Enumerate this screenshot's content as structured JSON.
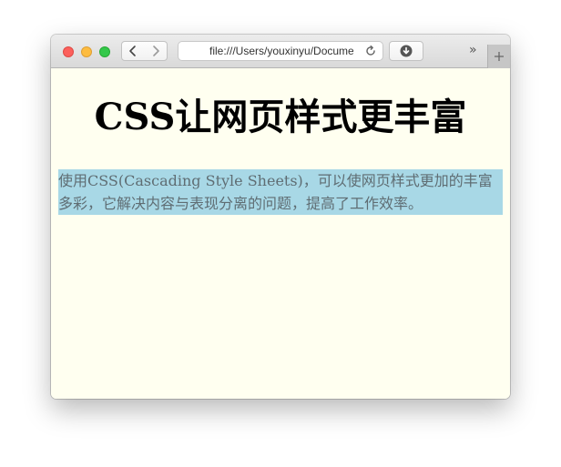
{
  "browser": {
    "url": "file:///Users/youxinyu/Documents/",
    "overflow_glyph": "»",
    "icons": {
      "back": "chevron-left-icon",
      "forward": "chevron-right-icon",
      "reload": "reload-icon",
      "downloads": "download-icon",
      "new_tab": "plus-icon"
    },
    "traffic_lights": {
      "close": "#fc605c",
      "minimize": "#fdbc40",
      "maximize": "#34c84a"
    }
  },
  "page": {
    "heading": "CSS让网页样式更丰富",
    "paragraph": "使用CSS(Cascading Style Sheets)，可以使网页样式更加的丰富多彩，它解决内容与表现分离的问题，提高了工作效率。",
    "colors": {
      "background": "#fffff0",
      "paragraph_background": "#a8d8e6",
      "paragraph_text": "#5f6d73",
      "heading_text": "#000000"
    }
  }
}
